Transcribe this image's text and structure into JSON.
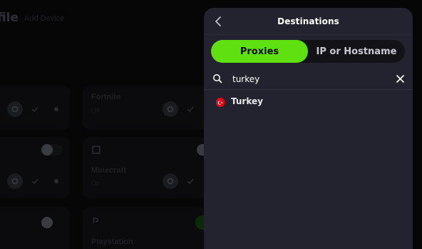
{
  "background": {
    "page_title": "file",
    "add_device_label": "Add Device",
    "tiles": [
      {
        "name": "Fortnite",
        "status": "Off"
      },
      {
        "name": "Minecraft",
        "status": "Off"
      },
      {
        "name": "Playstation",
        "status": ""
      }
    ]
  },
  "panel": {
    "title": "Destinations",
    "tabs": [
      {
        "label": "Proxies",
        "active": true
      },
      {
        "label": "IP or Hostname",
        "active": false
      }
    ],
    "search": {
      "value": "turkey",
      "placeholder": ""
    },
    "results": [
      {
        "label": "Turkey",
        "flag_icon": "turkey-flag-icon"
      }
    ]
  },
  "colors": {
    "accent": "#5fe010",
    "panel_bg": "#22232f",
    "segment_bg": "#121217",
    "flag_red": "#e30a17"
  }
}
